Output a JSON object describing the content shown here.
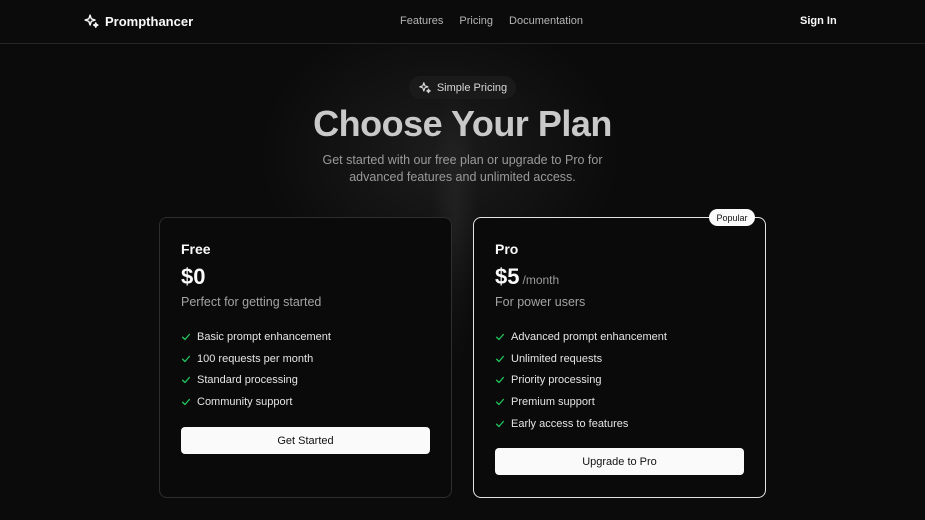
{
  "header": {
    "brand": "Prompthancer",
    "nav": [
      "Features",
      "Pricing",
      "Documentation"
    ],
    "sign_in": "Sign In"
  },
  "hero": {
    "badge": "Simple Pricing",
    "title": "Choose Your Plan",
    "subtitle": "Get started with our free plan or upgrade to Pro for advanced features and unlimited access."
  },
  "plans": [
    {
      "name": "Free",
      "price": "$0",
      "period": "",
      "description": "Perfect for getting started",
      "features": [
        "Basic prompt enhancement",
        "100 requests per month",
        "Standard processing",
        "Community support"
      ],
      "cta": "Get Started"
    },
    {
      "name": "Pro",
      "price": "$5",
      "period": "/month",
      "badge": "Popular",
      "description": "For power users",
      "features": [
        "Advanced prompt enhancement",
        "Unlimited requests",
        "Priority processing",
        "Premium support",
        "Early access to features"
      ],
      "cta": "Upgrade to Pro"
    }
  ],
  "colors": {
    "background": "#0b0b0b",
    "check": "#22c55e",
    "button_bg": "#fafafa",
    "border_pro": "#e3e3e3"
  },
  "icons": {
    "logo": "sparkles-icon",
    "badge": "sparkles-icon",
    "feature": "check-icon"
  }
}
